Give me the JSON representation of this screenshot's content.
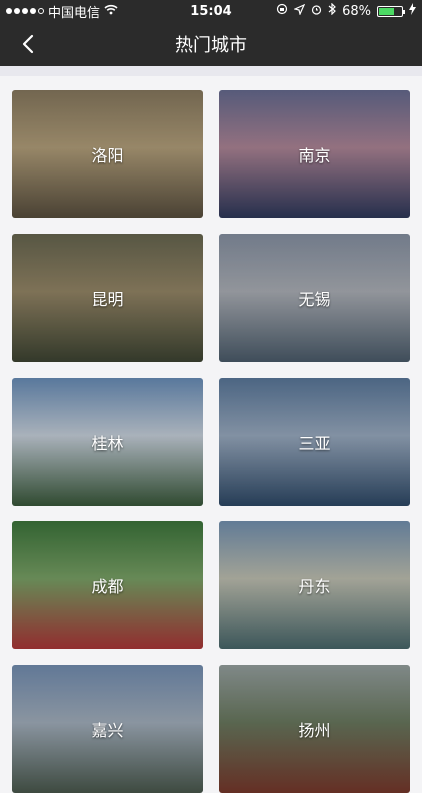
{
  "status_bar": {
    "carrier": "中国电信",
    "time": "15:04",
    "battery_percent": "68%",
    "battery_level": 0.68,
    "signal_icon": "signal-dots-icon",
    "wifi_icon": "wifi-icon"
  },
  "nav": {
    "title": "热门城市",
    "back_icon": "back-chevron-icon"
  },
  "cities": [
    {
      "name": "洛阳",
      "colors": [
        "#8c7d62",
        "#b9a57f",
        "#5b5140"
      ]
    },
    {
      "name": "南京",
      "colors": [
        "#6a6f95",
        "#b48a9c",
        "#2f3a5e"
      ]
    },
    {
      "name": "昆明",
      "colors": [
        "#6b6a53",
        "#9a8b6a",
        "#3f4634"
      ]
    },
    {
      "name": "无锡",
      "colors": [
        "#8b96a8",
        "#b2b6bd",
        "#4d5e6e"
      ]
    },
    {
      "name": "桂林",
      "colors": [
        "#6d93bf",
        "#cfd9e4",
        "#3b5b3c"
      ]
    },
    {
      "name": "三亚",
      "colors": [
        "#5d7ca0",
        "#9fb1c7",
        "#2f4b6a"
      ]
    },
    {
      "name": "成都",
      "colors": [
        "#3f7a3e",
        "#7ea86a",
        "#b2383a"
      ]
    },
    {
      "name": "丹东",
      "colors": [
        "#7897b7",
        "#c6c7b8",
        "#4a6a6e"
      ]
    },
    {
      "name": "嘉兴",
      "colors": [
        "#7793b8",
        "#a9b6c4",
        "#4c5b4f"
      ]
    },
    {
      "name": "扬州",
      "colors": [
        "#9ca7a6",
        "#6d7d62",
        "#7b3a2d"
      ]
    }
  ]
}
